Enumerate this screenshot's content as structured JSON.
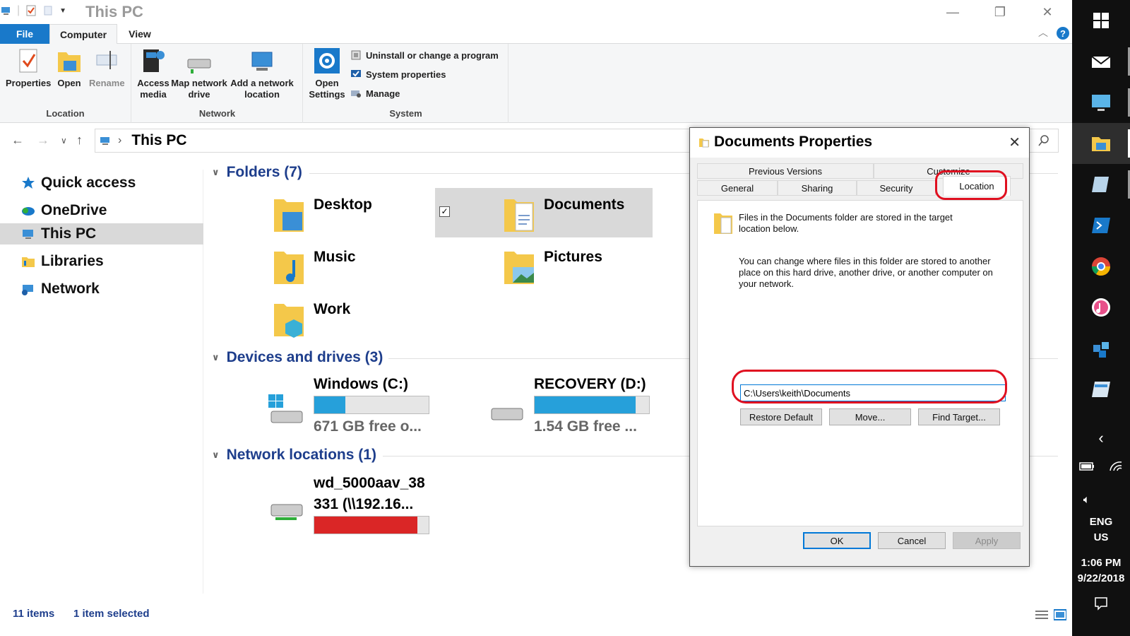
{
  "window": {
    "title": "This PC"
  },
  "ribbon": {
    "tabs": [
      "File",
      "Computer",
      "View"
    ],
    "location": {
      "label": "Location",
      "properties": "Properties",
      "open": "Open",
      "rename": "Rename"
    },
    "network": {
      "label": "Network",
      "access_media": "Access media",
      "map_drive": "Map network drive",
      "add_location": "Add a network location"
    },
    "system": {
      "label": "System",
      "open_settings": "Open Settings",
      "uninstall": "Uninstall or change a program",
      "system_props": "System properties",
      "manage": "Manage"
    }
  },
  "address": {
    "path": "This PC"
  },
  "nav": [
    {
      "label": "Quick access"
    },
    {
      "label": "OneDrive"
    },
    {
      "label": "This PC"
    },
    {
      "label": "Libraries"
    },
    {
      "label": "Network"
    }
  ],
  "sections": {
    "folders": "Folders (7)",
    "devices": "Devices and drives (3)",
    "network": "Network locations (1)"
  },
  "folders": [
    "Desktop",
    "Documents",
    "Music",
    "Pictures",
    "Work"
  ],
  "drives": [
    {
      "name": "Windows (C:)",
      "free": "671 GB free o...",
      "used_fraction": 0.27,
      "color": "#26a0da"
    },
    {
      "name": "RECOVERY (D:)",
      "free": "1.54 GB free ...",
      "used_fraction": 0.88,
      "color": "#26a0da"
    }
  ],
  "netloc": {
    "name_line1": "wd_5000aav_38",
    "name_line2": "331 (\\\\192.16...",
    "used_fraction": 0.9,
    "color": "#da2626"
  },
  "status": {
    "items": "11 items",
    "selected": "1 item selected"
  },
  "dialog": {
    "title": "Documents Properties",
    "tabs_row1": [
      "Previous Versions",
      "Customize"
    ],
    "tabs_row2": [
      "General",
      "Sharing",
      "Security",
      "Location"
    ],
    "info": "Files in the Documents folder are stored in the target location below.",
    "change_text": "You can change where files in this folder are stored to another place on this hard drive, another drive, or another computer on your network.",
    "path": "C:\\Users\\keith\\Documents",
    "buttons": {
      "restore": "Restore Default",
      "move": "Move...",
      "find": "Find Target...",
      "ok": "OK",
      "cancel": "Cancel",
      "apply": "Apply"
    }
  },
  "taskbar": {
    "lang1": "ENG",
    "lang2": "US",
    "time": "1:06 PM",
    "date": "9/22/2018"
  },
  "colors": {
    "accent": "#1979ca",
    "highlight": "#e01020",
    "header": "#1e3e8c"
  }
}
